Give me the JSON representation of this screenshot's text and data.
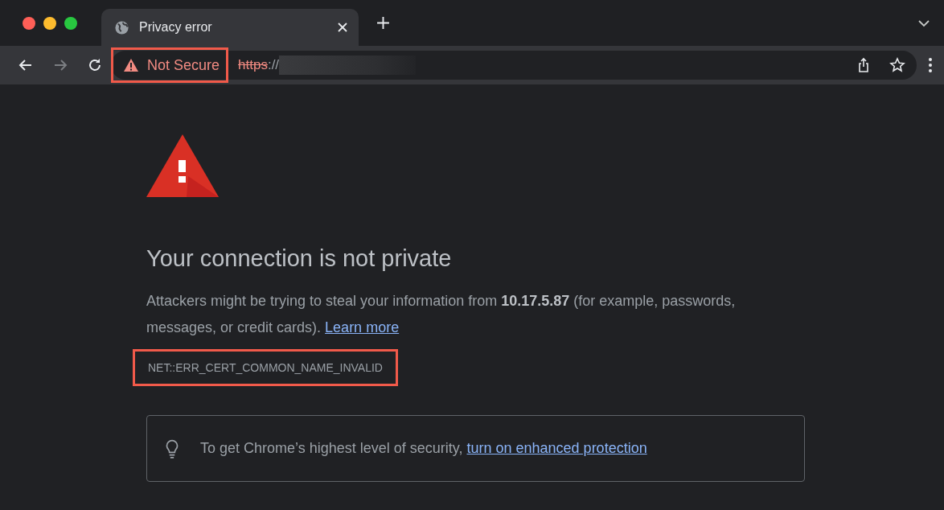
{
  "tabs": [
    {
      "title": "Privacy error",
      "selected": true
    }
  ],
  "toolbar": {
    "security_label": "Not Secure",
    "url_scheme": "https",
    "url_separator": "://",
    "highlighted": true
  },
  "page": {
    "heading": "Your connection is not private",
    "message": "Attackers might be trying to steal your information from **10.17.5.87** (for example, passwords, messages, or credit cards).",
    "learn_more": "Learn more",
    "error_code": "NET::ERR_CERT_COMMON_NAME_INVALID",
    "error_code_highlighted": true,
    "tip": "To get Chrome’s highest level of security,",
    "tip_link": "turn on enhanced protection"
  }
}
